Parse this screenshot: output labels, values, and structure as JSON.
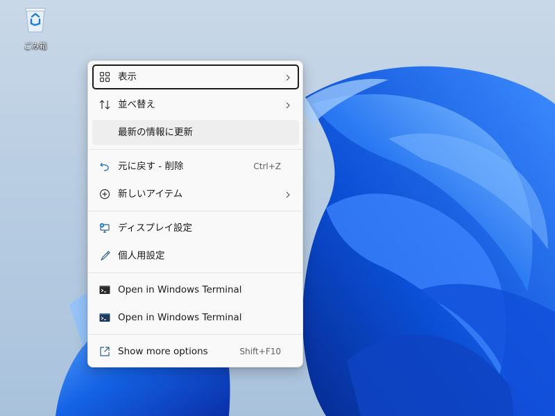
{
  "desktop": {
    "recycle_bin_label": "ごみ箱"
  },
  "context_menu": {
    "items": [
      {
        "label": "表示",
        "icon": "grid-icon",
        "has_submenu": true
      },
      {
        "label": "並べ替え",
        "icon": "sort-icon",
        "has_submenu": true
      },
      {
        "label": "最新の情報に更新",
        "icon": "",
        "has_submenu": false
      },
      {
        "label": "元に戻す - 削除",
        "icon": "undo-icon",
        "shortcut": "Ctrl+Z"
      },
      {
        "label": "新しいアイテム",
        "icon": "add-circle-icon",
        "has_submenu": true
      },
      {
        "label": "ディスプレイ設定",
        "icon": "display-settings-icon"
      },
      {
        "label": "個人用設定",
        "icon": "brush-icon"
      },
      {
        "label": "Open in Windows Terminal",
        "icon": "terminal-icon"
      },
      {
        "label": "Open in Windows Terminal",
        "icon": "terminal-blue-icon"
      },
      {
        "label": "Show more options",
        "icon": "share-icon",
        "shortcut": "Shift+F10"
      }
    ]
  },
  "colors": {
    "accent": "#0067c0",
    "menu_background": "#f9f9f9",
    "wallpaper_blue": "#1a5fe0"
  }
}
